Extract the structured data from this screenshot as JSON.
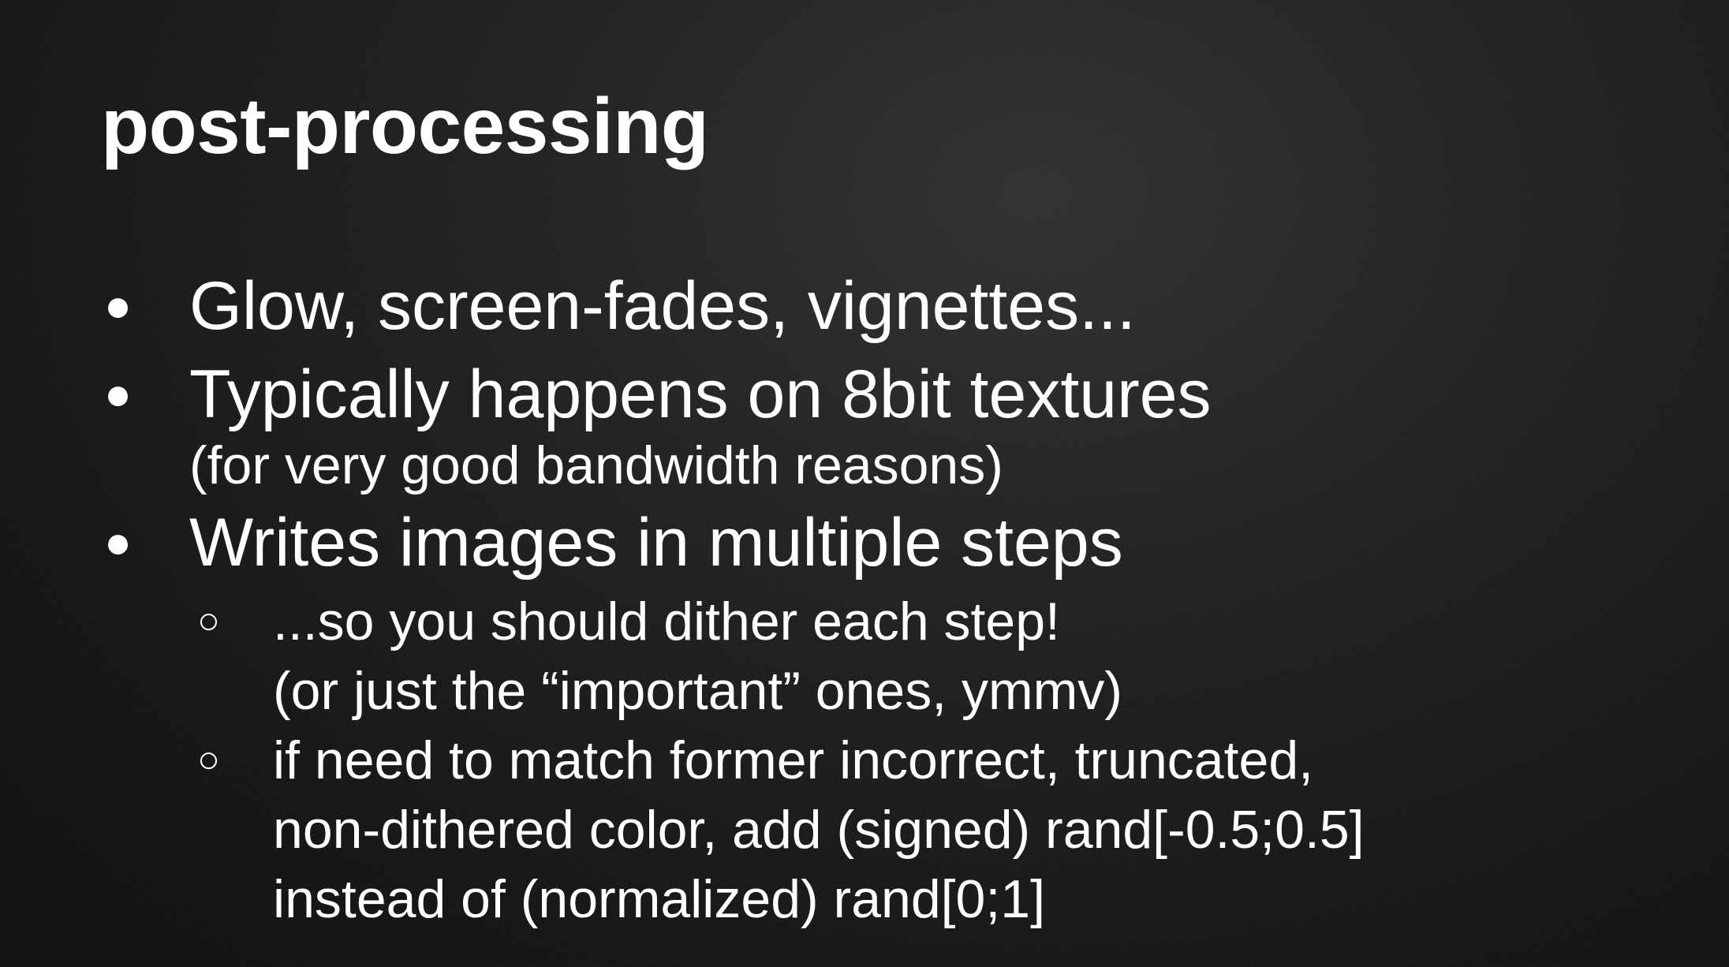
{
  "slide": {
    "title": "post-processing",
    "bullets": [
      {
        "text": "Glow, screen-fades, vignettes..."
      },
      {
        "text": "Typically happens on 8bit textures",
        "note": "(for very good bandwidth reasons)"
      },
      {
        "text": "Writes images in multiple steps",
        "subitems": [
          {
            "lines": [
              "...so you should dither each step!",
              "(or just the “important” ones, ymmv)"
            ]
          },
          {
            "lines": [
              "if need to match former incorrect, truncated,",
              "non-dithered color, add (signed) rand[-0.5;0.5]",
              "instead of (normalized) rand[0;1]"
            ]
          }
        ]
      }
    ]
  },
  "icons": {
    "bullet": "filled-circle-bullet-icon",
    "sub_bullet": "hollow-circle-bullet-icon"
  },
  "colors": {
    "background": "#111111",
    "text": "#ffffff"
  }
}
